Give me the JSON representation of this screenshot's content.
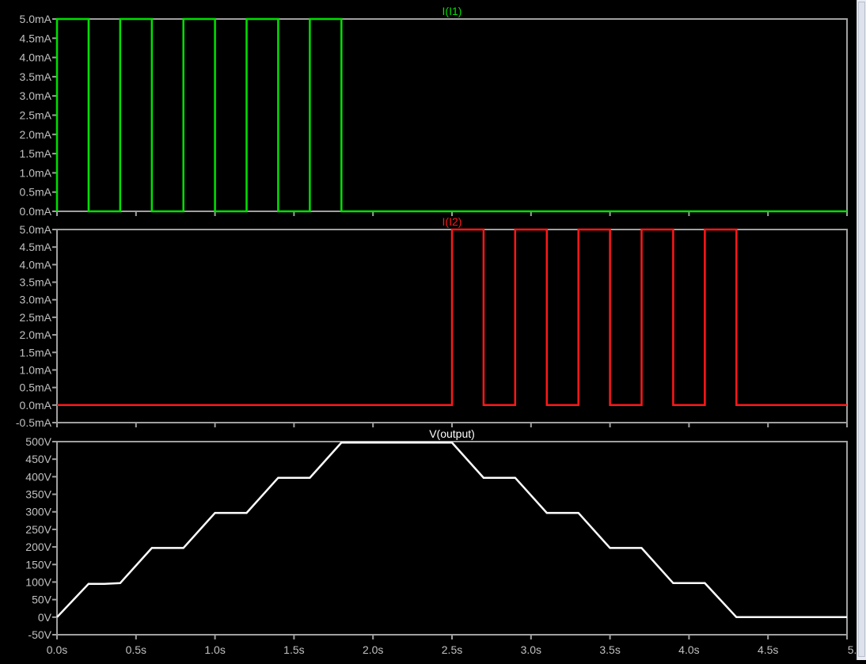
{
  "window": {
    "scrollbar": "vertical"
  },
  "colors": {
    "background": "#000000",
    "frame": "#a0a0a0",
    "tick_text": "#c0c0c0",
    "I1": "#00e000",
    "I2": "#ff1818",
    "output": "#ffffff"
  },
  "chart_data": [
    {
      "type": "line",
      "title": "I(I1)",
      "title_color": "#00e000",
      "series": [
        {
          "name": "I(I1)",
          "color": "#00e000",
          "unit": "mA",
          "x": [
            0,
            0,
            0.2,
            0.2,
            0.4,
            0.4,
            0.6,
            0.6,
            0.8,
            0.8,
            1.0,
            1.0,
            1.2,
            1.2,
            1.4,
            1.4,
            1.6,
            1.6,
            1.8,
            1.8,
            5.0
          ],
          "y": [
            0,
            5,
            5,
            0,
            0,
            5,
            5,
            0,
            0,
            5,
            5,
            0,
            0,
            5,
            5,
            0,
            0,
            5,
            5,
            0,
            0
          ]
        }
      ],
      "ylim": [
        0,
        5
      ],
      "yticks": [
        {
          "v": 5.0,
          "label": "5.0mA"
        },
        {
          "v": 4.5,
          "label": "4.5mA"
        },
        {
          "v": 4.0,
          "label": "4.0mA"
        },
        {
          "v": 3.5,
          "label": "3.5mA"
        },
        {
          "v": 3.0,
          "label": "3.0mA"
        },
        {
          "v": 2.5,
          "label": "2.5mA"
        },
        {
          "v": 2.0,
          "label": "2.0mA"
        },
        {
          "v": 1.5,
          "label": "1.5mA"
        },
        {
          "v": 1.0,
          "label": "1.0mA"
        },
        {
          "v": 0.5,
          "label": "0.5mA"
        },
        {
          "v": 0.0,
          "label": "0.0mA"
        }
      ],
      "xlim": [
        0,
        5
      ],
      "grid": false
    },
    {
      "type": "line",
      "title": "I(I2)",
      "title_color": "#ff1818",
      "series": [
        {
          "name": "I(I2)",
          "color": "#ff1818",
          "unit": "mA",
          "x": [
            0,
            2.5,
            2.5,
            2.7,
            2.7,
            2.9,
            2.9,
            3.1,
            3.1,
            3.3,
            3.3,
            3.5,
            3.5,
            3.7,
            3.7,
            3.9,
            3.9,
            4.1,
            4.1,
            4.3,
            4.3,
            5.0
          ],
          "y": [
            0,
            0,
            5,
            5,
            0,
            0,
            5,
            5,
            0,
            0,
            5,
            5,
            0,
            0,
            5,
            5,
            0,
            0,
            5,
            5,
            0,
            0
          ]
        }
      ],
      "ylim": [
        -0.5,
        5
      ],
      "yticks": [
        {
          "v": 5.0,
          "label": "5.0mA"
        },
        {
          "v": 4.5,
          "label": "4.5mA"
        },
        {
          "v": 4.0,
          "label": "4.0mA"
        },
        {
          "v": 3.5,
          "label": "3.5mA"
        },
        {
          "v": 3.0,
          "label": "3.0mA"
        },
        {
          "v": 2.5,
          "label": "2.5mA"
        },
        {
          "v": 2.0,
          "label": "2.0mA"
        },
        {
          "v": 1.5,
          "label": "1.5mA"
        },
        {
          "v": 1.0,
          "label": "1.0mA"
        },
        {
          "v": 0.5,
          "label": "0.5mA"
        },
        {
          "v": 0.0,
          "label": "0.0mA"
        },
        {
          "v": -0.5,
          "label": "-0.5mA"
        }
      ],
      "xlim": [
        0,
        5
      ],
      "grid": false
    },
    {
      "type": "line",
      "title": "V(output)",
      "title_color": "#ffffff",
      "series": [
        {
          "name": "V(output)",
          "color": "#ffffff",
          "unit": "V",
          "x": [
            0,
            0.2,
            0.3,
            0.4,
            0.6,
            0.8,
            1.0,
            1.2,
            1.4,
            1.6,
            1.8,
            2.5,
            2.7,
            2.9,
            3.1,
            3.3,
            3.5,
            3.7,
            3.9,
            4.1,
            4.3,
            5.0
          ],
          "y": [
            0,
            95,
            95,
            97,
            197,
            197,
            297,
            297,
            397,
            397,
            497,
            497,
            397,
            397,
            297,
            297,
            197,
            197,
            97,
            97,
            0,
            0
          ]
        }
      ],
      "ylim": [
        -50,
        500
      ],
      "yticks": [
        {
          "v": 500,
          "label": "500V"
        },
        {
          "v": 450,
          "label": "450V"
        },
        {
          "v": 400,
          "label": "400V"
        },
        {
          "v": 350,
          "label": "350V"
        },
        {
          "v": 300,
          "label": "300V"
        },
        {
          "v": 250,
          "label": "250V"
        },
        {
          "v": 200,
          "label": "200V"
        },
        {
          "v": 150,
          "label": "150V"
        },
        {
          "v": 100,
          "label": "100V"
        },
        {
          "v": 50,
          "label": "50V"
        },
        {
          "v": 0,
          "label": "0V"
        },
        {
          "v": -50,
          "label": "-50V"
        }
      ],
      "xlim": [
        0,
        5
      ],
      "xticks": [
        {
          "v": 0.0,
          "label": "0.0s"
        },
        {
          "v": 0.5,
          "label": "0.5s"
        },
        {
          "v": 1.0,
          "label": "1.0s"
        },
        {
          "v": 1.5,
          "label": "1.5s"
        },
        {
          "v": 2.0,
          "label": "2.0s"
        },
        {
          "v": 2.5,
          "label": "2.5s"
        },
        {
          "v": 3.0,
          "label": "3.0s"
        },
        {
          "v": 3.5,
          "label": "3.5s"
        },
        {
          "v": 4.0,
          "label": "4.0s"
        },
        {
          "v": 4.5,
          "label": "4.5s"
        },
        {
          "v": 5.0,
          "label": "5.0s"
        }
      ],
      "grid": false
    }
  ]
}
